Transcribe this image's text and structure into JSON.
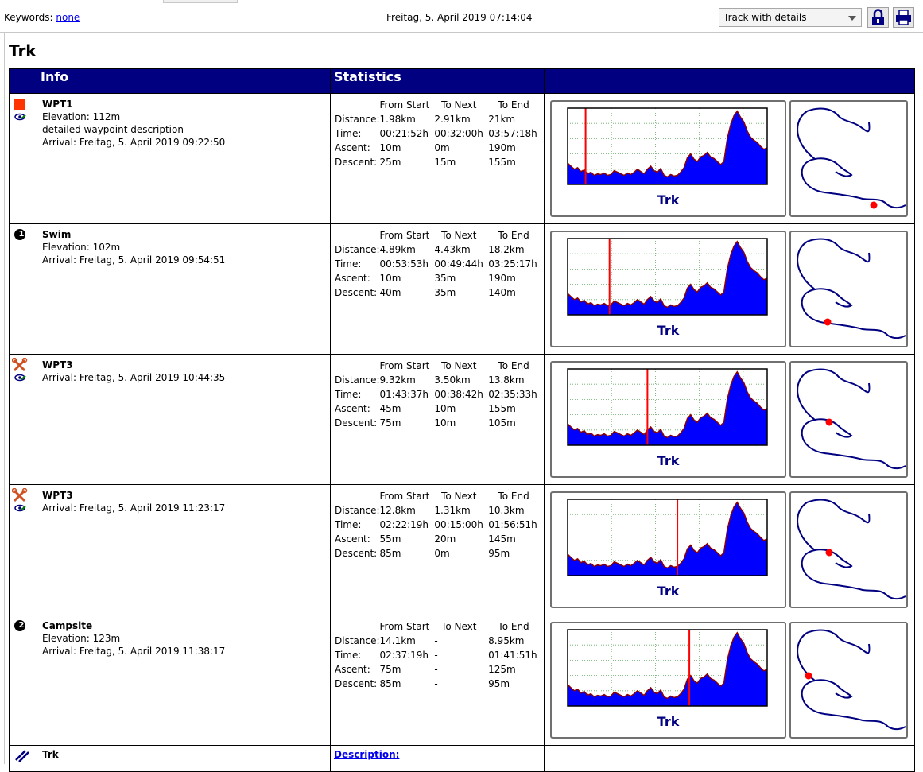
{
  "header": {
    "keywords_label": "Keywords:",
    "keywords_value": "none",
    "datetime": "Freitag, 5. April 2019 07:14:04",
    "view_select": "Track with details"
  },
  "page_title": "Trk",
  "table": {
    "columns": [
      "Info",
      "Statistics",
      ""
    ],
    "stats_headers": [
      "From Start",
      "To Next",
      "To End"
    ],
    "stats_row_labels": [
      "Distance:",
      "Time:",
      "Ascent:",
      "Descent:"
    ],
    "rows": [
      {
        "icon": "red-square-waypoint-icon",
        "number": "",
        "name": "WPT1",
        "details": [
          "Elevation: 112m",
          "detailed waypoint description",
          "Arrival: Freitag, 5. April 2019 09:22:50"
        ],
        "stats": [
          [
            "1.98km",
            "2.91km",
            "21km"
          ],
          [
            "00:21:52h",
            "00:32:00h",
            "03:57:18h"
          ],
          [
            "10m",
            "0m",
            "190m"
          ],
          [
            "25m",
            "15m",
            "155m"
          ]
        ],
        "plot_label": "Trk",
        "marker_fraction": 0.09
      },
      {
        "icon": "numbered-circle-icon",
        "number": "1",
        "name": "Swim",
        "details": [
          "Elevation: 102m",
          "Arrival: Freitag, 5. April 2019 09:54:51"
        ],
        "stats": [
          [
            "4.89km",
            "4.43km",
            "18.2km"
          ],
          [
            "00:53:53h",
            "00:49:44h",
            "03:25:17h"
          ],
          [
            "10m",
            "35m",
            "190m"
          ],
          [
            "40m",
            "35m",
            "140m"
          ]
        ],
        "plot_label": "Trk",
        "marker_fraction": 0.21
      },
      {
        "icon": "crossed-tools-icon",
        "number": "",
        "name": "WPT3",
        "details": [
          "Arrival: Freitag, 5. April 2019 10:44:35"
        ],
        "stats": [
          [
            "9.32km",
            "3.50km",
            "13.8km"
          ],
          [
            "01:43:37h",
            "00:38:42h",
            "02:35:33h"
          ],
          [
            "45m",
            "10m",
            "155m"
          ],
          [
            "75m",
            "10m",
            "105m"
          ]
        ],
        "plot_label": "Trk",
        "marker_fraction": 0.4
      },
      {
        "icon": "crossed-tools-icon",
        "number": "",
        "name": "WPT3",
        "details": [
          "Arrival: Freitag, 5. April 2019 11:23:17"
        ],
        "stats": [
          [
            "12.8km",
            "1.31km",
            "10.3km"
          ],
          [
            "02:22:19h",
            "00:15:00h",
            "01:56:51h"
          ],
          [
            "55m",
            "20m",
            "145m"
          ],
          [
            "85m",
            "0m",
            "95m"
          ]
        ],
        "plot_label": "Trk",
        "marker_fraction": 0.55
      },
      {
        "icon": "numbered-circle-icon",
        "number": "2",
        "name": "Campsite",
        "details": [
          "Elevation: 123m",
          "Arrival: Freitag, 5. April 2019 11:38:17"
        ],
        "stats": [
          [
            "14.1km",
            "-",
            "8.95km"
          ],
          [
            "02:37:19h",
            "-",
            "01:41:51h"
          ],
          [
            "75m",
            "-",
            "125m"
          ],
          [
            "85m",
            "-",
            "95m"
          ]
        ],
        "plot_label": "Trk",
        "marker_fraction": 0.61
      }
    ],
    "track_row": {
      "name": "Trk",
      "description_label": "Description:"
    }
  },
  "colors": {
    "header_bg": "#000080",
    "profile_fill": "#0000ff",
    "profile_line": "#8b0000",
    "marker": "#ff0000",
    "track": "#000080"
  }
}
